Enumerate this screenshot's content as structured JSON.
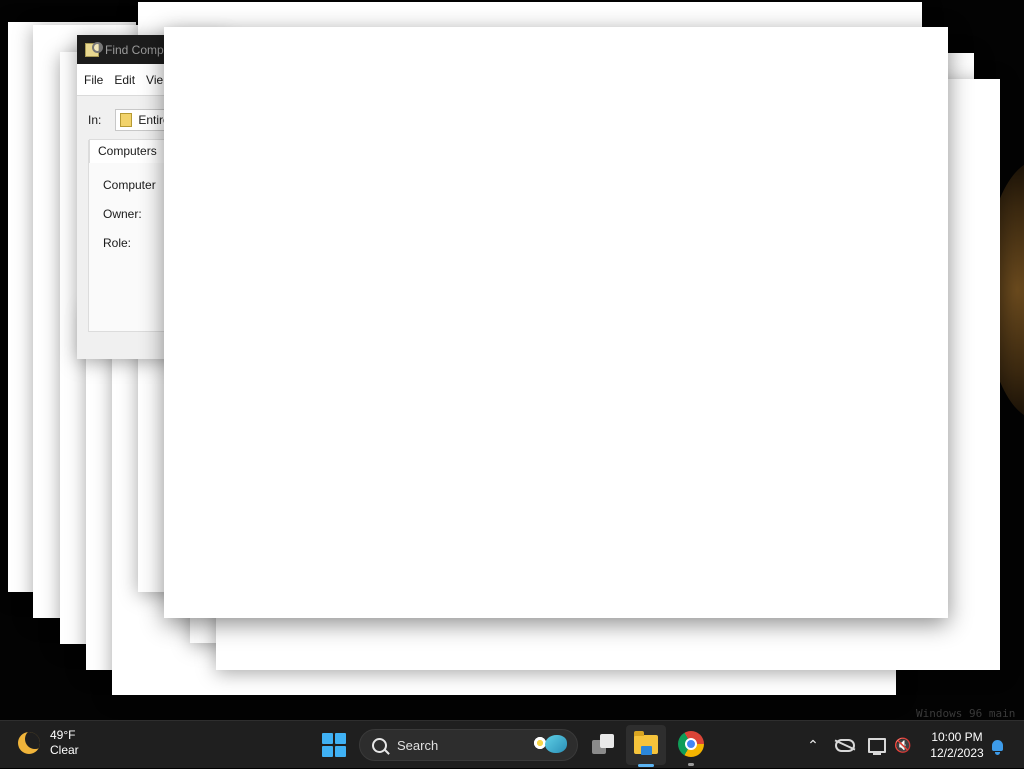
{
  "find_window": {
    "title": "Find Comp",
    "menu": [
      "File",
      "Edit",
      "Vie"
    ],
    "in_label": "In:",
    "in_value": "Entire",
    "tab": "Computers",
    "fields": [
      "Computer",
      "Owner:",
      "Role:"
    ]
  },
  "desktop": {
    "watermark": "Windows 96 main"
  },
  "taskbar": {
    "weather": {
      "temp": "49°F",
      "condition": "Clear"
    },
    "search_placeholder": "Search",
    "clock": {
      "time": "10:00 PM",
      "date": "12/2/2023"
    },
    "icons": {
      "start": "windows-logo",
      "task_view": "task-view-icon",
      "explorer": "file-explorer-icon",
      "chrome": "chrome-icon",
      "tray_chevron": "chevron-up-icon",
      "cloud": "onedrive-cloud-icon",
      "network": "network-icon",
      "volume": "volume-muted-icon",
      "notifications": "bell-icon"
    },
    "accent_color": "#3fb1f5"
  }
}
